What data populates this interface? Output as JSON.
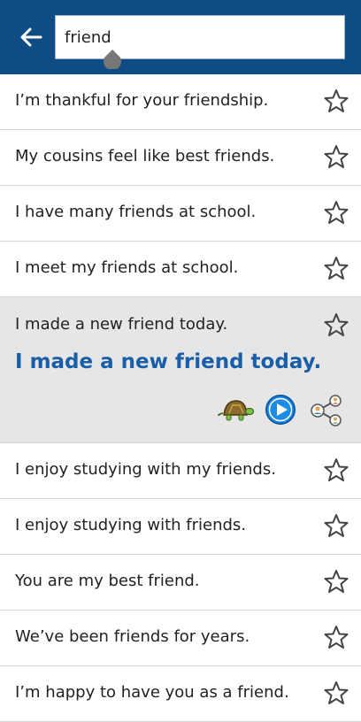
{
  "search": {
    "query": "friend"
  },
  "results": [
    {
      "text": "I’m thankful for your friendship."
    },
    {
      "text": "My cousins feel like best friends."
    },
    {
      "text": "I have many friends at school."
    },
    {
      "text": "I meet my friends at school."
    },
    {
      "text": "I made a new friend today.",
      "translation": "I made a new friend today."
    },
    {
      "text": "I enjoy studying with my friends."
    },
    {
      "text": "I enjoy studying with friends."
    },
    {
      "text": "You are my best friend."
    },
    {
      "text": "We’ve been friends for years."
    },
    {
      "text": "I’m happy to have you as a friend."
    }
  ],
  "icons": {
    "back": "back-arrow-icon",
    "favorite": "star-outline-icon",
    "slow": "turtle-icon",
    "play": "play-icon",
    "share": "share-icon"
  },
  "colors": {
    "header": "#0f4c86",
    "accent": "#1a5ea8",
    "play": "#1e8be6",
    "expanded_row": "#e6e6e6"
  }
}
